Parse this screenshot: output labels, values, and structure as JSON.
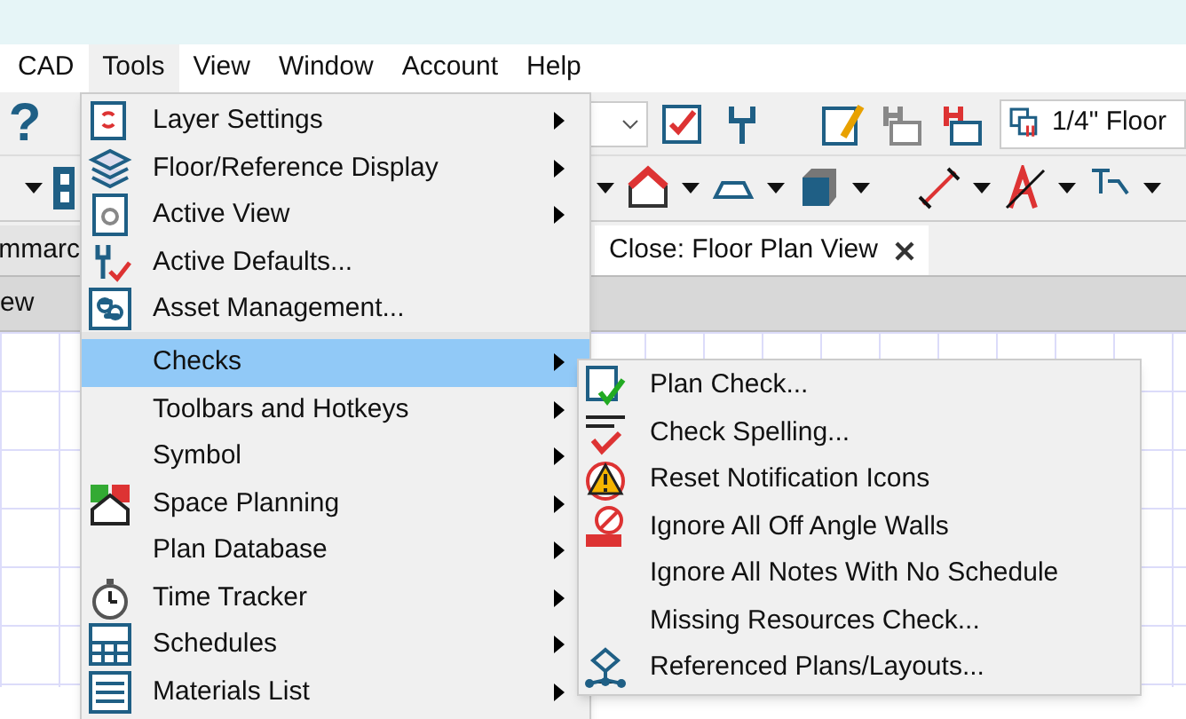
{
  "menubar": [
    {
      "label": "CAD",
      "selected": false
    },
    {
      "label": "Tools",
      "selected": true
    },
    {
      "label": "View",
      "selected": false
    },
    {
      "label": "Window",
      "selected": false
    },
    {
      "label": "Account",
      "selected": false
    },
    {
      "label": "Help",
      "selected": false
    }
  ],
  "toolbar": {
    "help_glyph": "?",
    "plan_scale": "1/4\" Floor"
  },
  "tabs": [
    {
      "label": "mmarc",
      "selected": false
    },
    {
      "label": "Close: Floor Plan View",
      "selected": true
    }
  ],
  "view_strip": "ew",
  "tools_menu": [
    {
      "label": "Layer Settings",
      "submenu": true,
      "selected": false
    },
    {
      "label": "Floor/Reference Display",
      "submenu": true,
      "selected": false
    },
    {
      "label": "Active View",
      "submenu": true,
      "selected": false
    },
    {
      "label": "Active Defaults...",
      "submenu": false,
      "selected": false
    },
    {
      "label": "Asset Management...",
      "submenu": false,
      "selected": false,
      "separator_after": true
    },
    {
      "label": "Checks",
      "submenu": true,
      "selected": true
    },
    {
      "label": "Toolbars and Hotkeys",
      "submenu": true,
      "selected": false
    },
    {
      "label": "Symbol",
      "submenu": true,
      "selected": false
    },
    {
      "label": "Space Planning",
      "submenu": true,
      "selected": false
    },
    {
      "label": "Plan Database",
      "submenu": true,
      "selected": false
    },
    {
      "label": "Time Tracker",
      "submenu": true,
      "selected": false
    },
    {
      "label": "Schedules",
      "submenu": true,
      "selected": false
    },
    {
      "label": "Materials List",
      "submenu": true,
      "selected": false
    }
  ],
  "checks_menu": [
    {
      "label": "Plan Check..."
    },
    {
      "label": "Check Spelling..."
    },
    {
      "label": "Reset Notification Icons"
    },
    {
      "label": "Ignore All Off Angle Walls"
    },
    {
      "label": "Ignore All Notes With No Schedule"
    },
    {
      "label": "Missing Resources Check..."
    },
    {
      "label": "Referenced Plans/Layouts..."
    }
  ]
}
